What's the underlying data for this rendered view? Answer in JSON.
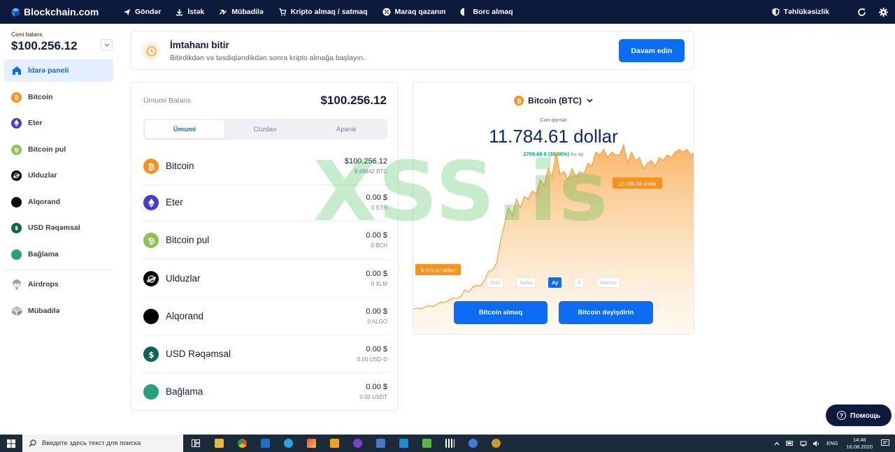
{
  "app": {
    "brand": "Blockchain.com"
  },
  "topnav": {
    "items": [
      {
        "label": "Göndər",
        "icon": "send-icon"
      },
      {
        "label": "İstək",
        "icon": "request-icon"
      },
      {
        "label": "Mübadilə",
        "icon": "swap-icon"
      },
      {
        "label": "Kripto almaq / satmaq",
        "icon": "cart-icon"
      },
      {
        "label": "Maraq qazanın",
        "icon": "interest-icon"
      },
      {
        "label": "Borc almaq",
        "icon": "borrow-icon"
      }
    ],
    "security": "Təhlükəsizlik"
  },
  "sidebar": {
    "balance_label": "Cəmi balans",
    "balance_value": "$100.256.12",
    "items": [
      {
        "label": "İdarə paneli",
        "icon": "home-icon",
        "color": "#0c6cf2"
      },
      {
        "label": "Bitcoin",
        "icon": "bitcoin-icon",
        "color": "#f7931a"
      },
      {
        "label": "Eter",
        "icon": "ether-icon",
        "color": "#473bcb"
      },
      {
        "label": "Bitcoin pul",
        "icon": "bitcoin-cash-icon",
        "color": "#8dc351"
      },
      {
        "label": "Ulduzlar",
        "icon": "stellar-icon",
        "color": "#000000"
      },
      {
        "label": "Alqorand",
        "icon": "algorand-icon",
        "color": "#000000"
      },
      {
        "label": "USD Rəqəmsal",
        "icon": "usd-digital-icon",
        "color": "#0a6650"
      },
      {
        "label": "Bağlama",
        "icon": "tether-icon",
        "color": "#26a17b"
      },
      {
        "label": "Airdrops",
        "icon": "parachute-icon",
        "color": "#98a1b2"
      },
      {
        "label": "Mübadilə",
        "icon": "exchange-icon",
        "color": "#98a1b2"
      }
    ]
  },
  "banner": {
    "title": "İmtahanı bitir",
    "subtitle": "Bitirdikdən və təsdiqləndikdən sonra kripto almağa başlayın.",
    "button": "Davam edin"
  },
  "portfolio": {
    "label": "Ümumi Balans",
    "total": "$100.256.12",
    "tabs": [
      "Ümumi",
      "Cüzdan",
      "Aparat"
    ],
    "assets": [
      {
        "name": "Bitcoin",
        "fiat": "$100.256.12",
        "crypto": "8.49842 BTC",
        "color": "#f7931a",
        "icon": "bitcoin-icon"
      },
      {
        "name": "Eter",
        "fiat": "0.00 $",
        "crypto": "0 ETH",
        "color": "#473bcb",
        "icon": "ether-icon"
      },
      {
        "name": "Bitcoin pul",
        "fiat": "0.00 $",
        "crypto": "0 BCH",
        "color": "#8dc351",
        "icon": "bitcoin-cash-icon"
      },
      {
        "name": "Ulduzlar",
        "fiat": "0.00 $",
        "crypto": "0 XLM",
        "color": "#000000",
        "icon": "stellar-icon"
      },
      {
        "name": "Alqorand",
        "fiat": "0.00 $",
        "crypto": "0 ALGO",
        "color": "#000000",
        "icon": "algorand-icon"
      },
      {
        "name": "USD Rəqəmsal",
        "fiat": "0.00 $",
        "crypto": "0.00 USD-D",
        "color": "#0a6650",
        "icon": "usd-digital-icon"
      },
      {
        "name": "Bağlama",
        "fiat": "0.00 $",
        "crypto": "0.00 USDT",
        "color": "#26a17b",
        "icon": "tether-icon"
      }
    ]
  },
  "price_card": {
    "coin": "Bitcoin (BTC)",
    "price_label": "Cari qiymət",
    "price": "11.784.61 dollar",
    "change": "2799.69 $ (30.86%)",
    "change_period": "bu ay",
    "high_label": "12 030.49 dollar",
    "low_label": "9 073.47 dollar",
    "ranges": [
      "Gün",
      "Həftə",
      "Ay",
      "İl",
      "Hamısı"
    ],
    "buy_button": "Bitcoin almaq",
    "swap_button": "Bitcoin dəyişdirin",
    "accent": "#f7931a"
  },
  "chart_data": {
    "type": "area",
    "ylim": [
      8600,
      12400
    ],
    "values": [
      9073,
      9090,
      9080,
      9110,
      9130,
      9120,
      9160,
      9200,
      9190,
      9230,
      9270,
      9260,
      9300,
      9420,
      9380,
      9470,
      9500,
      9490,
      9600,
      9750,
      9780,
      9900,
      10300,
      10600,
      10900,
      10750,
      11050,
      10900,
      11100,
      11050,
      11200,
      11150,
      11400,
      11300,
      11600,
      11450,
      11900,
      11500,
      11550,
      11400,
      11600,
      11450,
      11550,
      11500,
      11700,
      11650,
      11900,
      11850,
      11950,
      11800,
      11900,
      11850,
      11850,
      12030,
      11700,
      11900,
      11750,
      11800,
      11600,
      11700,
      11750,
      11650,
      11800,
      11750,
      11850,
      11800,
      11900,
      11950,
      11900,
      11950,
      11850,
      11900
    ]
  },
  "help": "Помощь",
  "watermark": "XSS.is",
  "taskbar": {
    "search_placeholder": "Введите здесь текст для поиска",
    "lang": "ENG",
    "time": "14:46",
    "date": "16.08.2020"
  }
}
